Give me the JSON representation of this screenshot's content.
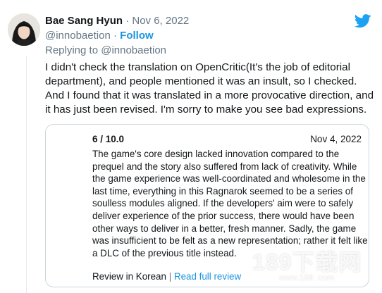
{
  "tweet": {
    "author": {
      "display_name": "Bae Sang Hyun",
      "handle": "@innobaetion",
      "avatar_icon": "profile-photo"
    },
    "date_separator": "·",
    "date": "Nov 6, 2022",
    "handle_separator": "·",
    "follow_label": "Follow",
    "replying_to": "Replying to @innobaetion",
    "body_lines": [
      "I didn't check the translation on OpenCritic(It's the job of editorial",
      "department), and people mentioned it was an insult, so I checked.",
      "And I found that it was translated in a more provocative direction, and",
      "it has just been revised. I'm sorry to make you see bad expressions."
    ],
    "logo_icon": "twitter-bird-icon",
    "brand_color": "#1DA1F2"
  },
  "card": {
    "score": "6 / 10.0",
    "date": "Nov 4, 2022",
    "text_lines": [
      "The game's core design lacked innovation compared to the",
      "prequel and the story also suffered from lack of creativity. While",
      "the game experience was well-coordinated and wholesome in the",
      "last time, everything in this Ragnarok seemed to be a series of",
      "soulless modules aligned. If the developers' aim were to safely",
      "deliver experience of the prior success, there would have been",
      "other ways to deliver in a better, fresh manner. Sadly, the game",
      "was insufficient to be felt as a new representation; rather it felt like",
      "a DLC of the previous title instead."
    ],
    "review_language": "Review in Korean",
    "footer_separator": "|",
    "read_full_label": "Read full review"
  },
  "watermark": {
    "main": "189下载网",
    "sub": "www.189 .com"
  },
  "colors": {
    "link": "#1B95E0",
    "secondary_text": "#657786",
    "border": "#CCD6DD"
  }
}
